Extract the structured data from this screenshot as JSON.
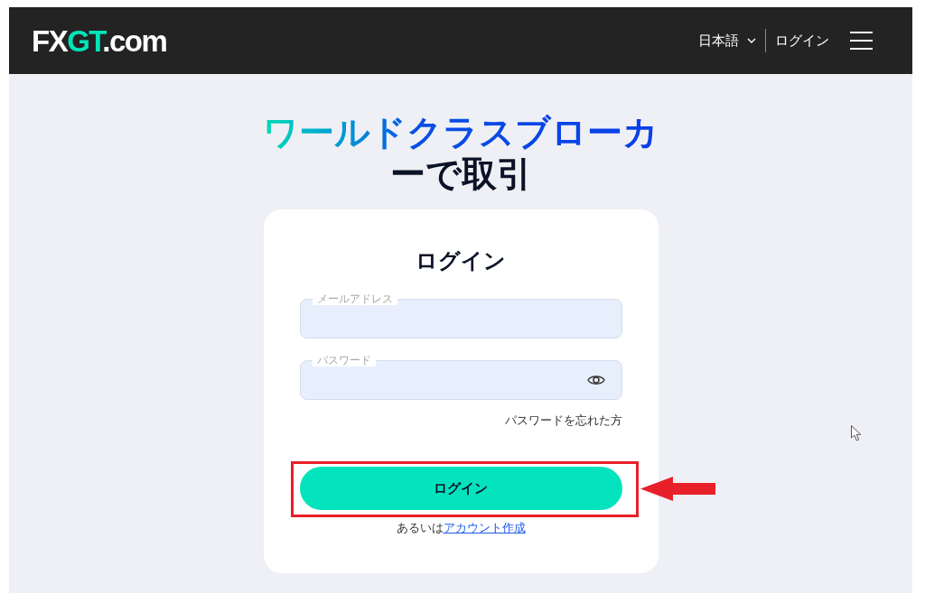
{
  "header": {
    "logo": {
      "prefix": "FX",
      "accent": "GT",
      "suffix": ".com"
    },
    "language": "日本語",
    "login_link": "ログイン"
  },
  "headline": {
    "highlight": "ワールドクラスブローカ",
    "rest": "ーで取引"
  },
  "login_card": {
    "title": "ログイン",
    "fields": [
      {
        "kind": "email",
        "label": "メールアドレス"
      },
      {
        "kind": "password",
        "label": "パスワード"
      }
    ],
    "forgot_password": "パスワードを忘れた方",
    "submit_button": "ログイン",
    "signup": {
      "prefix": "あるいは",
      "link": "アカウント作成"
    }
  }
}
